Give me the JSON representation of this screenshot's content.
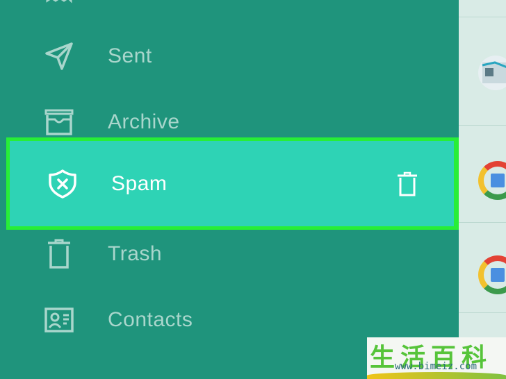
{
  "menu": {
    "items": [
      {
        "label": "Sent",
        "icon": "send-icon"
      },
      {
        "label": "Archive",
        "icon": "archive-icon"
      },
      {
        "label": "Spam",
        "icon": "shield-x-icon",
        "selected": true,
        "action_icon": "trash-icon"
      },
      {
        "label": "Trash",
        "icon": "trash-icon"
      },
      {
        "label": "Contacts",
        "icon": "contact-card-icon"
      }
    ]
  },
  "colors": {
    "sidebar_bg": "#1f947c",
    "selected_bg": "#2ed3b5",
    "highlight_border": "#27ee37",
    "label_muted": "#a9d6cc",
    "label_selected": "#ffffff"
  },
  "watermark": {
    "chars": "生活百科",
    "url": "www.bimeiz.com"
  }
}
